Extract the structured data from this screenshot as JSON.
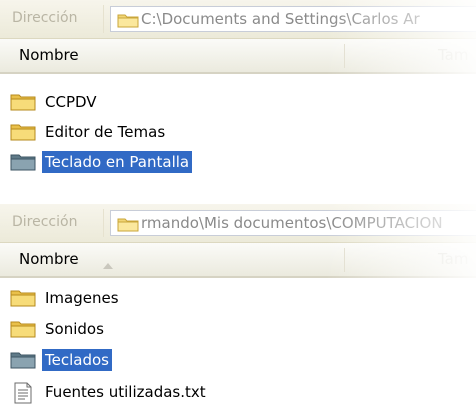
{
  "panel1": {
    "address_label": "Dirección",
    "address_path": "C:\\Documents and Settings\\Carlos Ar",
    "column_name": "Nombre",
    "column_ghost": "Tam",
    "items": [
      {
        "label": "CCPDV",
        "icon": "folder-icon",
        "selected": false
      },
      {
        "label": "Editor de Temas",
        "icon": "folder-icon",
        "selected": false
      },
      {
        "label": "Teclado en Pantalla",
        "icon": "folder-icon",
        "selected": true
      }
    ]
  },
  "panel2": {
    "address_label": "Dirección",
    "address_path": "rmando\\Mis documentos\\COMPUTACION",
    "column_name": "Nombre",
    "column_ghost": "Tam",
    "items": [
      {
        "label": "Imagenes",
        "icon": "folder-icon",
        "selected": false
      },
      {
        "label": "Sonidos",
        "icon": "folder-icon",
        "selected": false
      },
      {
        "label": "Teclados",
        "icon": "folder-icon",
        "selected": true
      },
      {
        "label": "Fuentes utilizadas.txt",
        "icon": "text-file-icon",
        "selected": false
      }
    ]
  },
  "colors": {
    "selection": "#316ac5",
    "folder_yellow": "#f4d35e",
    "folder_selected": "#6f8a99"
  }
}
